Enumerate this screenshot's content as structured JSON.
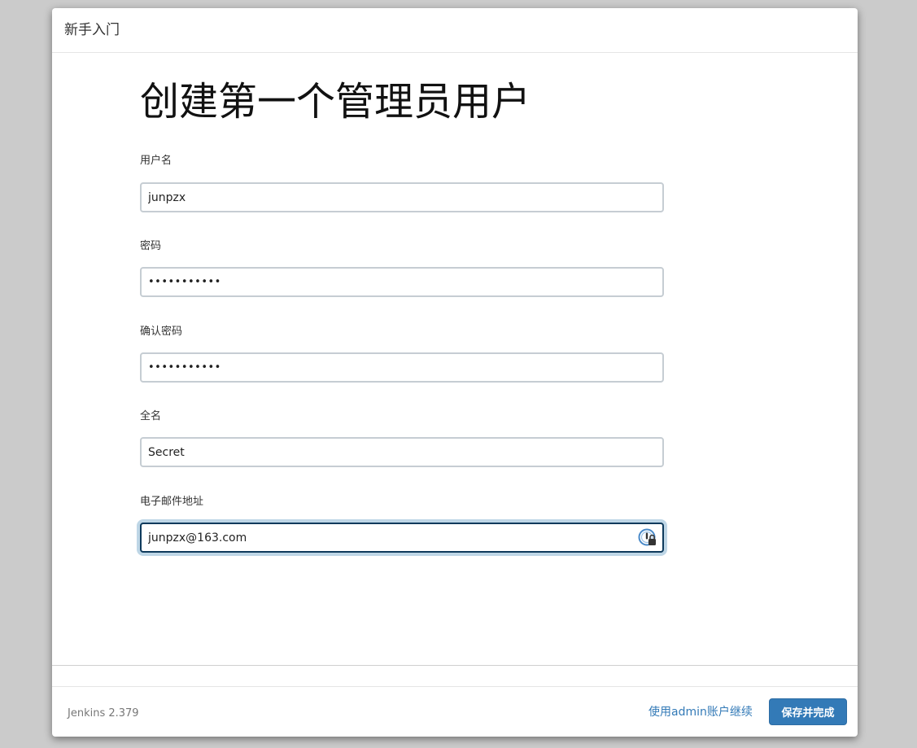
{
  "dialog": {
    "title": "新手入门"
  },
  "page_title": "创建第一个管理员用户",
  "form": {
    "username": {
      "label": "用户名",
      "value": "junpzx"
    },
    "password": {
      "label": "密码",
      "value": "•••••••••••"
    },
    "confirm_password": {
      "label": "确认密码",
      "value": "•••••••••••"
    },
    "full_name": {
      "label": "全名",
      "value": "Secret"
    },
    "email": {
      "label": "电子邮件地址",
      "value": "junpzx@163.com"
    }
  },
  "footer": {
    "version": "Jenkins 2.379",
    "continue_as_admin_label": "使用admin账户继续",
    "save_and_finish_label": "保存并完成"
  },
  "colors": {
    "primary": "#337ab7",
    "background_overlay": "#cbcbcb",
    "focus_border": "#0e3a5c",
    "focus_glow": "#bed6e6"
  }
}
